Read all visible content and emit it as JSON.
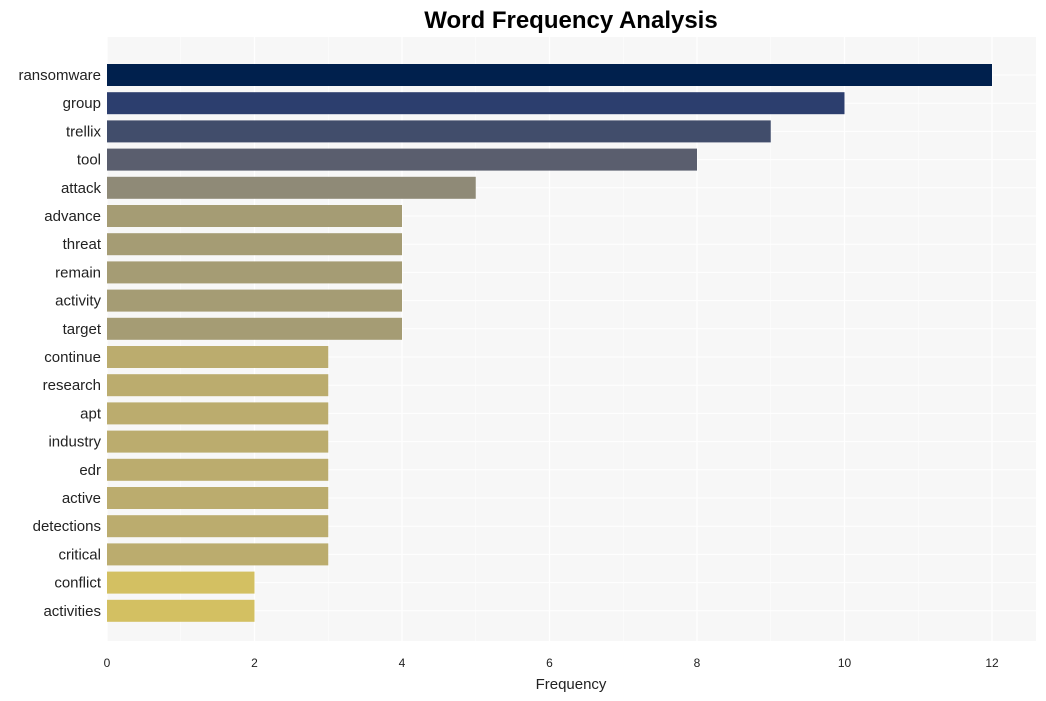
{
  "chart_data": {
    "type": "bar",
    "orientation": "horizontal",
    "title": "Word Frequency Analysis",
    "xlabel": "Frequency",
    "ylabel": "",
    "xlim": [
      0,
      12.6
    ],
    "xticks": [
      0,
      2,
      4,
      6,
      8,
      10,
      12
    ],
    "grid": true,
    "legend": "none",
    "categories": [
      "ransomware",
      "group",
      "trellix",
      "tool",
      "attack",
      "advance",
      "threat",
      "remain",
      "activity",
      "target",
      "continue",
      "research",
      "apt",
      "industry",
      "edr",
      "active",
      "detections",
      "critical",
      "conflict",
      "activities"
    ],
    "values": [
      12,
      10,
      9,
      8,
      5,
      4,
      4,
      4,
      4,
      4,
      3,
      3,
      3,
      3,
      3,
      3,
      3,
      3,
      2,
      2
    ],
    "colors": [
      "#00204d",
      "#2c3e6e",
      "#414d6b",
      "#5a5e6e",
      "#8f8a77",
      "#a59c74",
      "#a59c74",
      "#a59c74",
      "#a59c74",
      "#a59c74",
      "#bbac6e",
      "#bbac6e",
      "#bbac6e",
      "#bbac6e",
      "#bbac6e",
      "#bbac6e",
      "#bbac6e",
      "#bbac6e",
      "#d3c062",
      "#d3c062"
    ]
  }
}
